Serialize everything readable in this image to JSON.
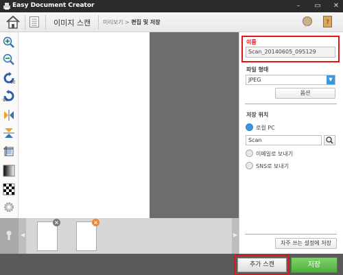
{
  "titlebar": {
    "title": "Easy Document Creator",
    "icons": [
      "printer-icon",
      "minimize-icon",
      "restore-icon",
      "close-icon"
    ]
  },
  "toolbar": {
    "title": "이미지 스캔",
    "breadcrumb_prev": "미리보기",
    "breadcrumb_sep": ">",
    "breadcrumb_current": "편집 및 저장"
  },
  "left_tools": [
    "zoom-in-icon",
    "zoom-out-icon",
    "rotate-90-ccw-icon",
    "rotate-90-cw-icon",
    "flip-horizontal-icon",
    "flip-vertical-icon",
    "crop-icon",
    "grayscale-icon",
    "checker-icon",
    "gear-icon"
  ],
  "rotate_labels": {
    "ccw": "90",
    "cw": "90"
  },
  "panel": {
    "name_label": "이름",
    "name_value": "Scan_20140605_095129",
    "filetype_label": "파일 형태",
    "filetype_value": "JPEG",
    "options_button": "옵션",
    "save_location_label": "저장 위치",
    "option_local_pc": "로컬 PC",
    "folder_value": "Scan",
    "option_email": "이메일로 보내기",
    "option_sns": "SNS로 보내기",
    "frequent_settings_button": "자주 쓰는 설정에 저장"
  },
  "thumbnails": [
    {
      "badge": "x",
      "badge_color": "#7a7a7a"
    },
    {
      "badge": "x",
      "badge_color": "#e7873a"
    }
  ],
  "footer": {
    "add_scan": "추가 스캔",
    "save": "저장"
  },
  "colors": {
    "highlight": "#e0141b",
    "accent": "#3b95e0",
    "save_green": "#4fae3c"
  }
}
